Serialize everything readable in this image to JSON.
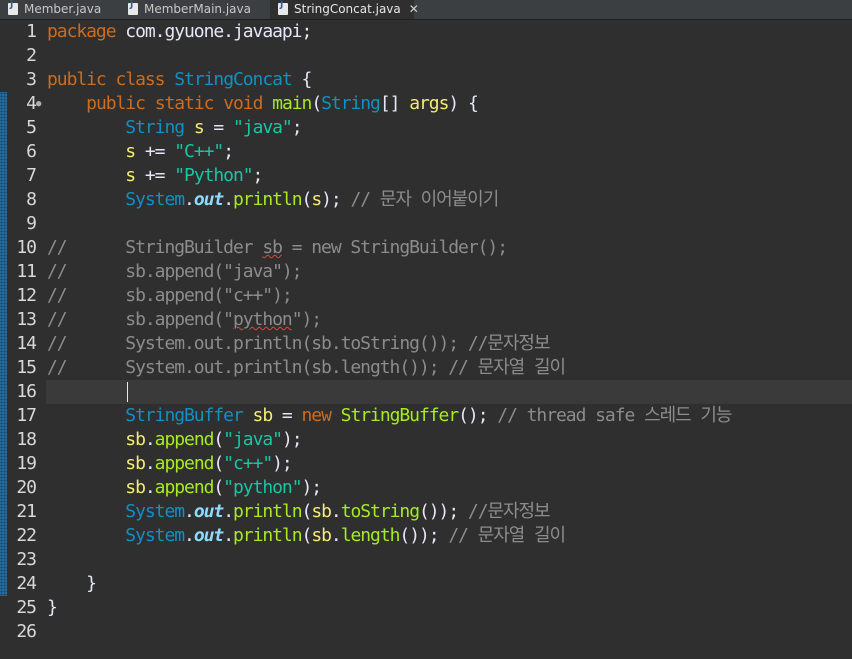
{
  "tabs": [
    {
      "label": "Member.java",
      "active": false
    },
    {
      "label": "MemberMain.java",
      "active": false
    },
    {
      "label": "StringConcat.java",
      "active": true
    }
  ],
  "tab_close_glyph": "✕",
  "lines": [
    {
      "n": "1",
      "tokens": [
        {
          "t": "kw",
          "v": "package"
        },
        {
          "t": "op",
          "v": " com.gyuone.javaapi;"
        }
      ]
    },
    {
      "n": "2",
      "tokens": []
    },
    {
      "n": "3",
      "tokens": [
        {
          "t": "kw",
          "v": "public"
        },
        {
          "t": "op",
          "v": " "
        },
        {
          "t": "kw",
          "v": "class"
        },
        {
          "t": "op",
          "v": " "
        },
        {
          "t": "cls",
          "v": "StringConcat"
        },
        {
          "t": "op",
          "v": " {"
        }
      ]
    },
    {
      "n": "4",
      "fold": true,
      "tokens": [
        {
          "t": "op",
          "v": "    "
        },
        {
          "t": "kw",
          "v": "public"
        },
        {
          "t": "op",
          "v": " "
        },
        {
          "t": "kw",
          "v": "static"
        },
        {
          "t": "op",
          "v": " "
        },
        {
          "t": "kw",
          "v": "void"
        },
        {
          "t": "op",
          "v": " "
        },
        {
          "t": "fn",
          "v": "main"
        },
        {
          "t": "op",
          "v": "("
        },
        {
          "t": "cls",
          "v": "String"
        },
        {
          "t": "op",
          "v": "[] "
        },
        {
          "t": "var",
          "v": "args"
        },
        {
          "t": "op",
          "v": ") {"
        }
      ]
    },
    {
      "n": "5",
      "tokens": [
        {
          "t": "op",
          "v": "        "
        },
        {
          "t": "cls",
          "v": "String"
        },
        {
          "t": "op",
          "v": " "
        },
        {
          "t": "var",
          "v": "s"
        },
        {
          "t": "op",
          "v": " = "
        },
        {
          "t": "str",
          "v": "\"java\""
        },
        {
          "t": "op",
          "v": ";"
        }
      ]
    },
    {
      "n": "6",
      "tokens": [
        {
          "t": "op",
          "v": "        "
        },
        {
          "t": "var",
          "v": "s"
        },
        {
          "t": "op",
          "v": " += "
        },
        {
          "t": "str",
          "v": "\"C++\""
        },
        {
          "t": "op",
          "v": ";"
        }
      ]
    },
    {
      "n": "7",
      "tokens": [
        {
          "t": "op",
          "v": "        "
        },
        {
          "t": "var",
          "v": "s"
        },
        {
          "t": "op",
          "v": " += "
        },
        {
          "t": "str",
          "v": "\"Python\""
        },
        {
          "t": "op",
          "v": ";"
        }
      ]
    },
    {
      "n": "8",
      "tokens": [
        {
          "t": "op",
          "v": "        "
        },
        {
          "t": "cls",
          "v": "System"
        },
        {
          "t": "op",
          "v": "."
        },
        {
          "t": "fld",
          "v": "out"
        },
        {
          "t": "op",
          "v": "."
        },
        {
          "t": "fn",
          "v": "println"
        },
        {
          "t": "op",
          "v": "("
        },
        {
          "t": "var",
          "v": "s"
        },
        {
          "t": "op",
          "v": "); "
        },
        {
          "t": "cmt",
          "v": "// 문자 이어붙이기"
        }
      ]
    },
    {
      "n": "9",
      "tokens": []
    },
    {
      "n": "10",
      "tokens": [
        {
          "t": "cmt",
          "v": "//      StringBuilder "
        },
        {
          "t": "cmt err",
          "v": "sb"
        },
        {
          "t": "cmt",
          "v": " = new StringBuilder();"
        }
      ]
    },
    {
      "n": "11",
      "tokens": [
        {
          "t": "cmt",
          "v": "//      sb.append(\"java\");"
        }
      ]
    },
    {
      "n": "12",
      "tokens": [
        {
          "t": "cmt",
          "v": "//      sb.append(\"c++\");"
        }
      ]
    },
    {
      "n": "13",
      "tokens": [
        {
          "t": "cmt",
          "v": "//      sb.append(\""
        },
        {
          "t": "cmt err",
          "v": "python"
        },
        {
          "t": "cmt",
          "v": "\");"
        }
      ]
    },
    {
      "n": "14",
      "tokens": [
        {
          "t": "cmt",
          "v": "//      System.out.println(sb.toString()); //문자정보"
        }
      ]
    },
    {
      "n": "15",
      "tokens": [
        {
          "t": "cmt",
          "v": "//      System.out.println(sb.length()); // 문자열 길이"
        }
      ]
    },
    {
      "n": "16",
      "tokens": []
    },
    {
      "n": "17",
      "tokens": [
        {
          "t": "op",
          "v": "        "
        },
        {
          "t": "cls",
          "v": "StringBuffer"
        },
        {
          "t": "op",
          "v": " "
        },
        {
          "t": "var",
          "v": "sb"
        },
        {
          "t": "op",
          "v": " = "
        },
        {
          "t": "kw",
          "v": "new"
        },
        {
          "t": "op",
          "v": " "
        },
        {
          "t": "fn",
          "v": "StringBuffer"
        },
        {
          "t": "op",
          "v": "(); "
        },
        {
          "t": "cmt",
          "v": "// thread safe 스레드 기능"
        }
      ]
    },
    {
      "n": "18",
      "tokens": [
        {
          "t": "op",
          "v": "        "
        },
        {
          "t": "var",
          "v": "sb"
        },
        {
          "t": "op",
          "v": "."
        },
        {
          "t": "fn",
          "v": "append"
        },
        {
          "t": "op",
          "v": "("
        },
        {
          "t": "str",
          "v": "\"java\""
        },
        {
          "t": "op",
          "v": ");"
        }
      ]
    },
    {
      "n": "19",
      "tokens": [
        {
          "t": "op",
          "v": "        "
        },
        {
          "t": "var",
          "v": "sb"
        },
        {
          "t": "op",
          "v": "."
        },
        {
          "t": "fn",
          "v": "append"
        },
        {
          "t": "op",
          "v": "("
        },
        {
          "t": "str",
          "v": "\"c++\""
        },
        {
          "t": "op",
          "v": ");"
        }
      ]
    },
    {
      "n": "20",
      "tokens": [
        {
          "t": "op",
          "v": "        "
        },
        {
          "t": "var",
          "v": "sb"
        },
        {
          "t": "op",
          "v": "."
        },
        {
          "t": "fn",
          "v": "append"
        },
        {
          "t": "op",
          "v": "("
        },
        {
          "t": "str",
          "v": "\"python\""
        },
        {
          "t": "op",
          "v": ");"
        }
      ]
    },
    {
      "n": "21",
      "tokens": [
        {
          "t": "op",
          "v": "        "
        },
        {
          "t": "cls",
          "v": "System"
        },
        {
          "t": "op",
          "v": "."
        },
        {
          "t": "fld",
          "v": "out"
        },
        {
          "t": "op",
          "v": "."
        },
        {
          "t": "fn",
          "v": "println"
        },
        {
          "t": "op",
          "v": "("
        },
        {
          "t": "var",
          "v": "sb"
        },
        {
          "t": "op",
          "v": "."
        },
        {
          "t": "fn",
          "v": "toString"
        },
        {
          "t": "op",
          "v": "()); "
        },
        {
          "t": "cmt",
          "v": "//문자정보"
        }
      ]
    },
    {
      "n": "22",
      "tokens": [
        {
          "t": "op",
          "v": "        "
        },
        {
          "t": "cls",
          "v": "System"
        },
        {
          "t": "op",
          "v": "."
        },
        {
          "t": "fld",
          "v": "out"
        },
        {
          "t": "op",
          "v": "."
        },
        {
          "t": "fn",
          "v": "println"
        },
        {
          "t": "op",
          "v": "("
        },
        {
          "t": "var",
          "v": "sb"
        },
        {
          "t": "op",
          "v": "."
        },
        {
          "t": "fn",
          "v": "length"
        },
        {
          "t": "op",
          "v": "()); "
        },
        {
          "t": "cmt",
          "v": "// 문자열 길이"
        }
      ]
    },
    {
      "n": "23",
      "tokens": []
    },
    {
      "n": "24",
      "tokens": [
        {
          "t": "op",
          "v": "    }"
        }
      ]
    },
    {
      "n": "25",
      "tokens": [
        {
          "t": "op",
          "v": "}"
        }
      ]
    },
    {
      "n": "26",
      "tokens": []
    }
  ],
  "colors": {
    "background": "#2f2f2f",
    "keyword": "#cc6c1d",
    "class": "#1290c3",
    "method": "#a7ec21",
    "variable": "#f3ec79",
    "string": "#17c6a3",
    "static_field": "#8dd9ff",
    "comment": "#8c8c8c",
    "spelling_error_underline": "#e0453a"
  },
  "icons": {
    "tab_file_icon": "java-file-icon",
    "fold_marker": "fold-marker-icon"
  }
}
